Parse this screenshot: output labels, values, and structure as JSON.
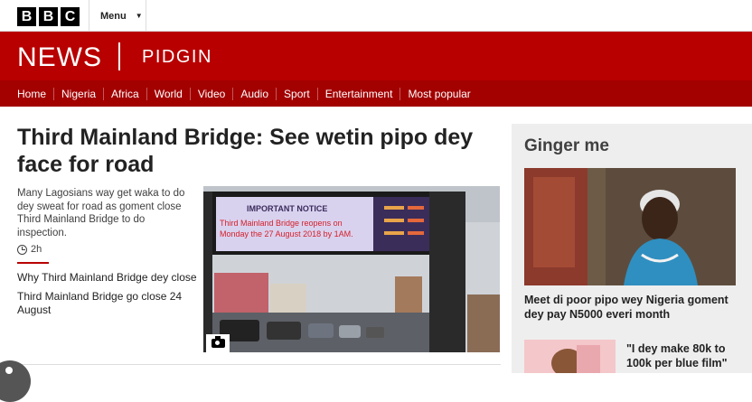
{
  "header": {
    "logo_letters": [
      "B",
      "B",
      "C"
    ],
    "menu_label": "Menu",
    "menu_icon": "chevron-down-icon"
  },
  "masthead": {
    "brand": "NEWS",
    "edition": "PIDGIN",
    "color": "#b80000"
  },
  "nav": {
    "items": [
      "Home",
      "Nigeria",
      "Africa",
      "World",
      "Video",
      "Audio",
      "Sport",
      "Entertainment",
      "Most popular"
    ]
  },
  "main_story": {
    "headline": "Third Mainland Bridge: See wetin pipo dey face for road",
    "summary": "Many Lagosians way get waka to do dey sweat for road as goment close Third Mainland Bridge to do inspection.",
    "time": "2h",
    "related": [
      "Why Third Mainland Bridge dey close",
      "Third Mainland Bridge go close 24 August"
    ],
    "image": {
      "billboard_title": "IMPORTANT NOTICE",
      "billboard_line1": "Third Mainland Bridge reopens on",
      "billboard_line2": "Monday the 27 August 2018 by 1AM."
    },
    "media_icon": "camera-icon"
  },
  "sidebar": {
    "title": "Ginger me",
    "stories": [
      {
        "headline": "Meet di poor pipo wey Nigeria goment dey pay N5000 everi month"
      },
      {
        "headline": "\"I dey make 80k to 100k per blue film\""
      }
    ]
  }
}
